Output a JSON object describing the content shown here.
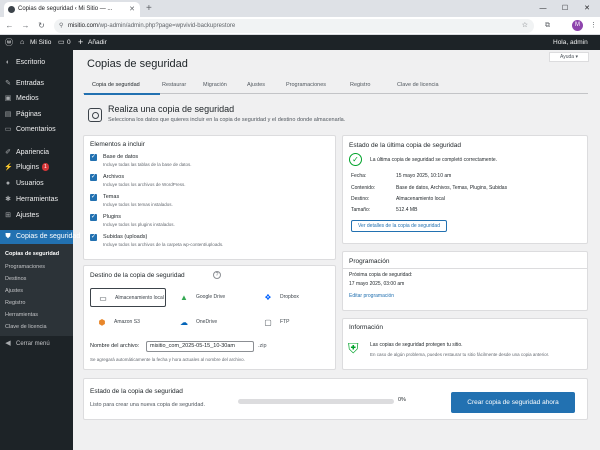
{
  "browser": {
    "tab_title": "Copias de seguridad ‹ Mi Sitio — ...",
    "url_host": "misitio.com",
    "url_path": "/wp-admin/admin.php?page=wpvivid-backuprestore",
    "avatar_letter": "M"
  },
  "adminbar": {
    "site_name": "Mi Sitio",
    "comments_count": "0",
    "new_label": "Añadir",
    "greeting": "Hola, admin"
  },
  "sidebar": {
    "items": [
      {
        "label": "Escritorio",
        "icon": "dashboard-icon"
      },
      {
        "label": "Entradas",
        "icon": "pin-icon"
      },
      {
        "label": "Medios",
        "icon": "media-icon"
      },
      {
        "label": "Páginas",
        "icon": "page-icon"
      },
      {
        "label": "Comentarios",
        "icon": "comment-icon"
      },
      {
        "label": "Apariencia",
        "icon": "brush-icon"
      },
      {
        "label": "Plugins",
        "icon": "plug-icon",
        "badge": "1"
      },
      {
        "label": "Usuarios",
        "icon": "user-icon"
      },
      {
        "label": "Herramientas",
        "icon": "wrench-icon"
      },
      {
        "label": "Ajustes",
        "icon": "settings-icon"
      },
      {
        "label": "Copias de seguridad",
        "icon": "backup-icon"
      }
    ],
    "submenu": [
      "Copias de seguridad",
      "Programaciones",
      "Destinos",
      "Ajustes",
      "Registro",
      "Herramientas",
      "Clave de licencia"
    ],
    "collapse": "Cerrar menú"
  },
  "page": {
    "help": "Ayuda ▾",
    "title": "Copias de seguridad",
    "tabs": [
      "Copia de seguridad",
      "Restaurar",
      "Migración",
      "Ajustes",
      "Programaciones",
      "Registro",
      "Clave de licencia"
    ],
    "header_title": "Realiza una copia de seguridad",
    "header_desc": "Selecciona los datos que quieres incluir en la copia de seguridad y el destino donde almacenarla."
  },
  "elements": {
    "title": "Elementos a incluir",
    "items": [
      {
        "label": "Base de datos",
        "desc": "Incluye todas las tablas de la base de datos."
      },
      {
        "label": "Archivos",
        "desc": "Incluye todos los archivos de WordPress."
      },
      {
        "label": "Temas",
        "desc": "Incluye todos los temas instalados."
      },
      {
        "label": "Plugins",
        "desc": "Incluye todos los plugins instalados."
      },
      {
        "label": "Subidas (uploads)",
        "desc": "Incluye todos los archivos de la carpeta wp-content/uploads."
      }
    ]
  },
  "destination": {
    "title": "Destino de la copia de seguridad",
    "options": [
      "Almacenamiento local",
      "Google Drive",
      "Dropbox",
      "Amazon S3",
      "OneDrive",
      "FTP"
    ],
    "filename_label": "Nombre del archivo:",
    "filename_value": "misitio_com_2025-05-15_10-30am",
    "filename_ext": ".zip",
    "note": "Se agregará automáticamente la fecha y hora actuales al nombre del archivo."
  },
  "last_backup": {
    "title": "Estado de la última copia de seguridad",
    "success": "La última copia de seguridad se completó correctamente.",
    "rows": [
      {
        "k": "Fecha:",
        "v": "15 mayo 2025, 10:10 am"
      },
      {
        "k": "Contenido:",
        "v": "Base de datos, Archivos, Temas, Plugins, Subidas"
      },
      {
        "k": "Destino:",
        "v": "Almacenamiento local"
      },
      {
        "k": "Tamaño:",
        "v": "512.4 MB"
      }
    ],
    "details_button": "Ver detalles de la copia de seguridad"
  },
  "schedule": {
    "title": "Programación",
    "next_label": "Próxima copia de seguridad:",
    "next_value": "17 mayo 2025, 03:00 am",
    "edit_link": "Editar programación"
  },
  "info": {
    "title": "Información",
    "line1": "Las copias de seguridad protegen tu sitio.",
    "line2": "En caso de algún problema, puedes restaurar tu sitio fácilmente desde una copia anterior."
  },
  "status": {
    "title": "Estado de la copia de seguridad",
    "text": "Listo para crear una nueva copia de seguridad.",
    "progress": 0,
    "progress_label": "0%",
    "create_button": "Crear copia de seguridad ahora"
  }
}
